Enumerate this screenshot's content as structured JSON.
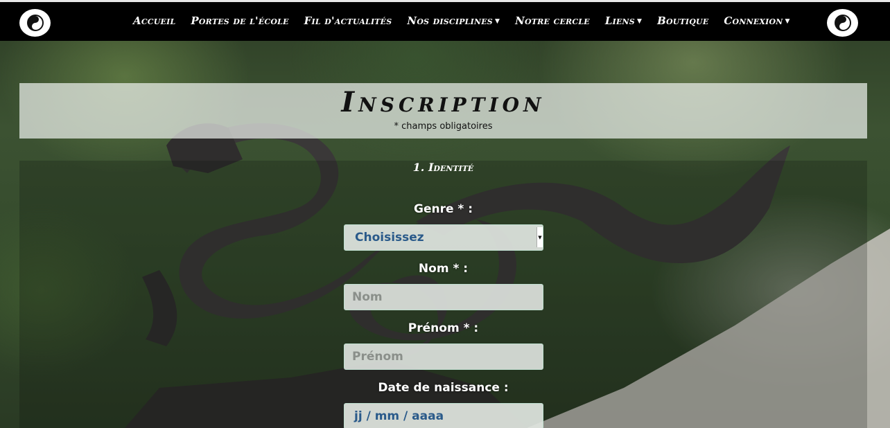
{
  "nav": {
    "items": [
      {
        "label": "Accueil",
        "dropdown": false
      },
      {
        "label": "Portes de l'école",
        "dropdown": false
      },
      {
        "label": "Fil d'actualités",
        "dropdown": false
      },
      {
        "label": "Nos disciplines",
        "dropdown": true
      },
      {
        "label": "Notre cercle",
        "dropdown": false
      },
      {
        "label": "Liens",
        "dropdown": true
      },
      {
        "label": "Boutique",
        "dropdown": false
      },
      {
        "label": "Connexion",
        "dropdown": true
      }
    ]
  },
  "page": {
    "title": "Inscription",
    "required_note": "* champs obligatoires"
  },
  "form": {
    "section_title": "1. Identité",
    "genre": {
      "label": "Genre * :",
      "value": "Choisissez"
    },
    "nom": {
      "label": "Nom * :",
      "placeholder": "Nom"
    },
    "prenom": {
      "label": "Prénom * :",
      "placeholder": "Prénom"
    },
    "date": {
      "label": "Date de naissance :",
      "placeholder": "jj / mm / aaaa"
    }
  }
}
